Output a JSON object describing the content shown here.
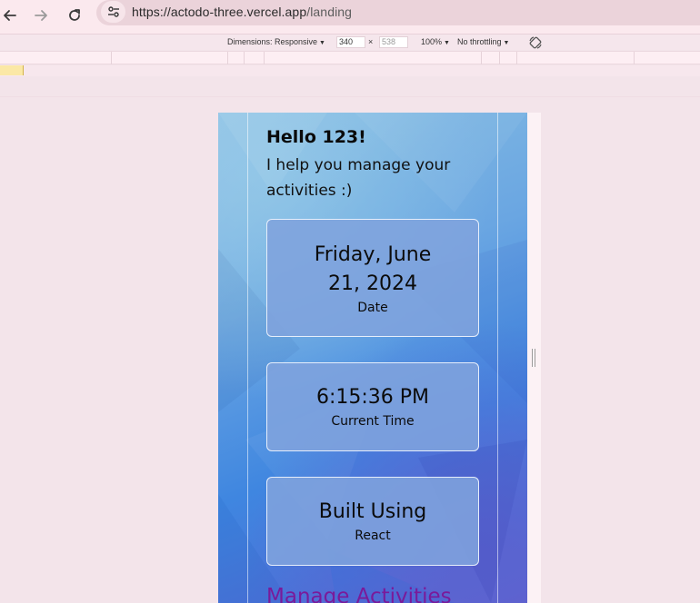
{
  "browser": {
    "url_host": "https://actodo-three.vercel.app",
    "url_path": "/landing"
  },
  "devtools": {
    "dimensions_label": "Dimensions: Responsive",
    "width_value": "340",
    "times_sign": "×",
    "height_placeholder": "538",
    "zoom_label": "100%",
    "throttling_label": "No throttling"
  },
  "page": {
    "greeting": "Hello 123!",
    "subtitle": "I help you manage your activities :)",
    "cards": {
      "date": {
        "value_line1": "Friday, June",
        "value_line2": "21, 2024",
        "label": "Date"
      },
      "time": {
        "value": "6:15:36 PM",
        "label": "Current Time"
      },
      "built": {
        "value": "Built Using",
        "label": "React"
      }
    },
    "manage_heading": "Manage Activities"
  },
  "colors": {
    "manage_heading": "#7a1a9a",
    "card_background": "#7fa3dd"
  }
}
